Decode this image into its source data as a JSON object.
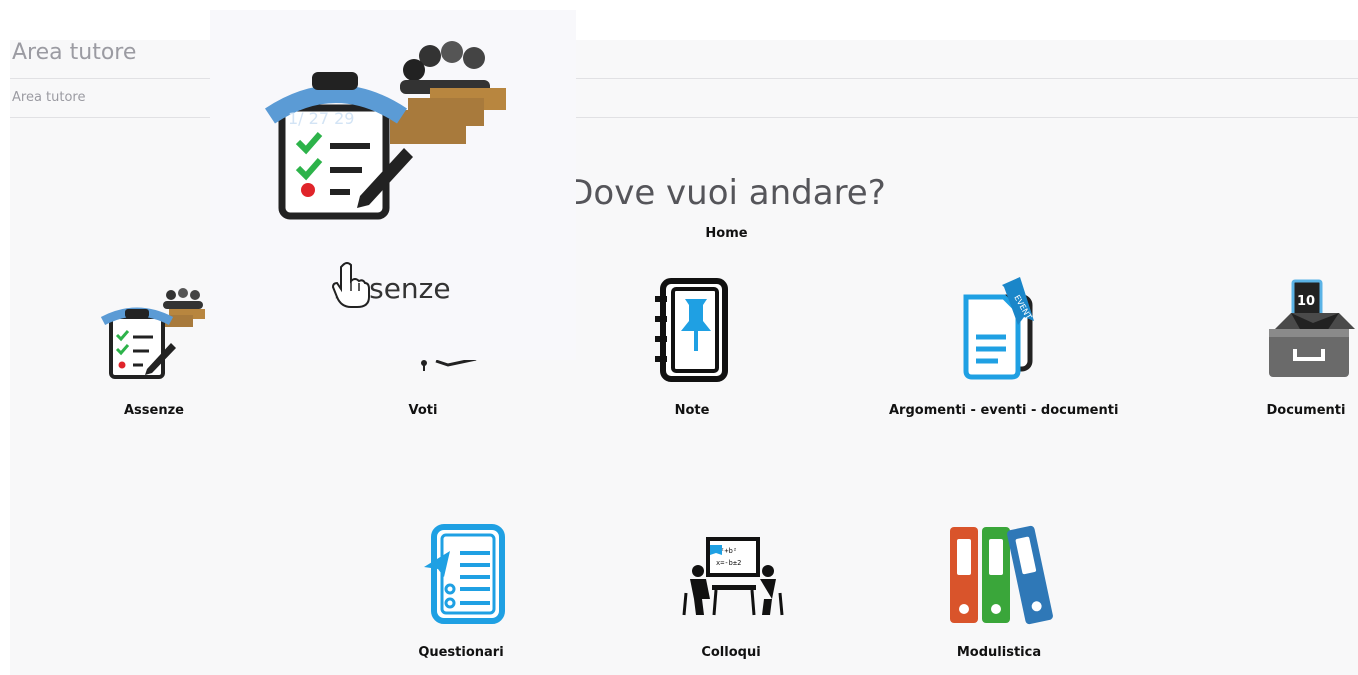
{
  "header": {
    "title": "Area tutore"
  },
  "breadcrumb": {
    "current": "Area tutore"
  },
  "main": {
    "heading": "Dove vuoi andare?",
    "home_label": "Home",
    "tiles": [
      {
        "label": "Assenze",
        "icon": "attendance-clipboard-icon"
      },
      {
        "label": "Voti",
        "icon": "grades-icon"
      },
      {
        "label": "Note",
        "icon": "notebook-pin-icon"
      },
      {
        "label": "Argomenti - eventi - documenti",
        "icon": "event-document-icon"
      },
      {
        "label": "Documenti",
        "icon": "document-tray-icon"
      },
      {
        "label": "Questionari",
        "icon": "questionnaire-icon"
      },
      {
        "label": "Colloqui",
        "icon": "meeting-icon"
      },
      {
        "label": "Modulistica",
        "icon": "binders-icon"
      }
    ]
  },
  "hover_preview": {
    "label": "Assenze",
    "icon": "attendance-clipboard-icon",
    "cursor": "hand-pointer-icon"
  },
  "colors": {
    "clipboard_blue": "#5b9bd5",
    "desk_brown": "#a87a3c",
    "accent_blue": "#1fa0e3",
    "binder_orange": "#d9542b",
    "binder_green": "#3aa63a",
    "binder_blue": "#2f78b7"
  }
}
